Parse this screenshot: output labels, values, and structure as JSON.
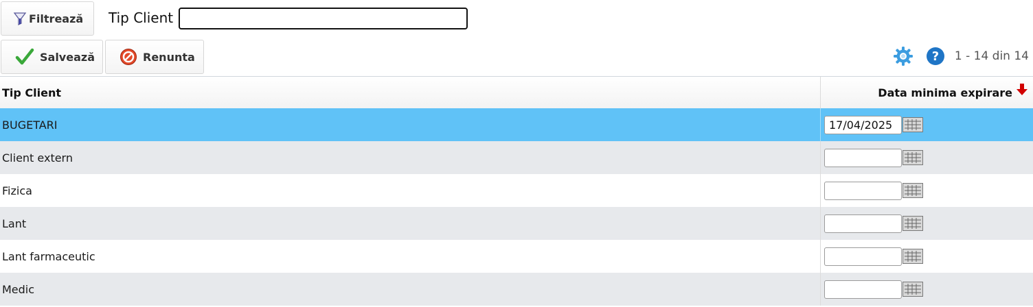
{
  "filter": {
    "button_label": "Filtrează",
    "field_label": "Tip Client",
    "field_value": ""
  },
  "toolbar": {
    "save_label": "Salvează",
    "cancel_label": "Renunta",
    "pager_text": "1 - 14 din 14",
    "icons": [
      "funnel-icon",
      "checkmark-icon",
      "cancel-icon",
      "gear-icon",
      "help-icon",
      "sort-desc-icon",
      "calendar-icon"
    ]
  },
  "grid": {
    "columns": [
      "Tip Client",
      "Data minima expirare"
    ],
    "sort": {
      "column": "Data minima expirare",
      "direction": "desc"
    },
    "rows": [
      {
        "tip": "BUGETARI",
        "data": "17/04/2025",
        "selected": true
      },
      {
        "tip": "Client extern",
        "data": ""
      },
      {
        "tip": "Fizica",
        "data": ""
      },
      {
        "tip": "Lant",
        "data": ""
      },
      {
        "tip": "Lant farmaceutic",
        "data": ""
      },
      {
        "tip": "Medic",
        "data": ""
      }
    ]
  },
  "colors": {
    "selected_row": "#60c2f7",
    "alt_row": "#e7e9ec",
    "accent_blue": "#1f75c6",
    "sort_arrow": "#d10000"
  }
}
